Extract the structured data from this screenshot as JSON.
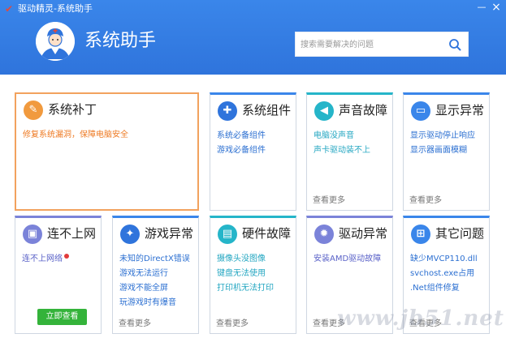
{
  "window": {
    "title": "驱动精灵-系统助手",
    "minimize_glyph": "—",
    "close_glyph": "×"
  },
  "header": {
    "title": "系统助手",
    "search_placeholder": "搜索需要解决的问题"
  },
  "colors": {
    "header_blue": "#3a86ea",
    "link_blue": "#2b6fd1",
    "highlight_orange": "#ee7a23",
    "button_green": "#34b33a"
  },
  "cards": [
    {
      "title": "系统补丁",
      "icon": "patch-icon",
      "links": [
        "修复系统漏洞，保障电脑安全"
      ],
      "more": ""
    },
    {
      "title": "系统组件",
      "icon": "puzzle-icon",
      "links": [
        "系统必备组件",
        "游戏必备组件"
      ],
      "more": ""
    },
    {
      "title": "声音故障",
      "icon": "speaker-icon",
      "links": [
        "电脑没声音",
        "声卡驱动装不上"
      ],
      "more": "查看更多"
    },
    {
      "title": "显示异常",
      "icon": "monitor-icon",
      "links": [
        "显示驱动停止响应",
        "显示器画面模糊"
      ],
      "more": "查看更多"
    },
    {
      "title": "连不上网",
      "icon": "network-icon",
      "links": [
        "连不上网络"
      ],
      "button": "立即查看"
    },
    {
      "title": "游戏异常",
      "icon": "gamepad-icon",
      "links": [
        "未知的DirectX错误",
        "游戏无法运行",
        "游戏不能全屏",
        "玩游戏时有爆音"
      ],
      "more": "查看更多"
    },
    {
      "title": "硬件故障",
      "icon": "hardware-icon",
      "links": [
        "摄像头没图像",
        "键盘无法使用",
        "打印机无法打印"
      ],
      "more": "查看更多"
    },
    {
      "title": "驱动异常",
      "icon": "gear-icon",
      "links": [
        "安装AMD驱动故障"
      ],
      "more": "查看更多"
    },
    {
      "title": "其它问题",
      "icon": "windows-icon",
      "links": [
        "缺少MVCP110.dll",
        "svchost.exe占用",
        ".Net组件修复"
      ],
      "more": "查看更多"
    }
  ],
  "watermark": "www.jb51.net"
}
